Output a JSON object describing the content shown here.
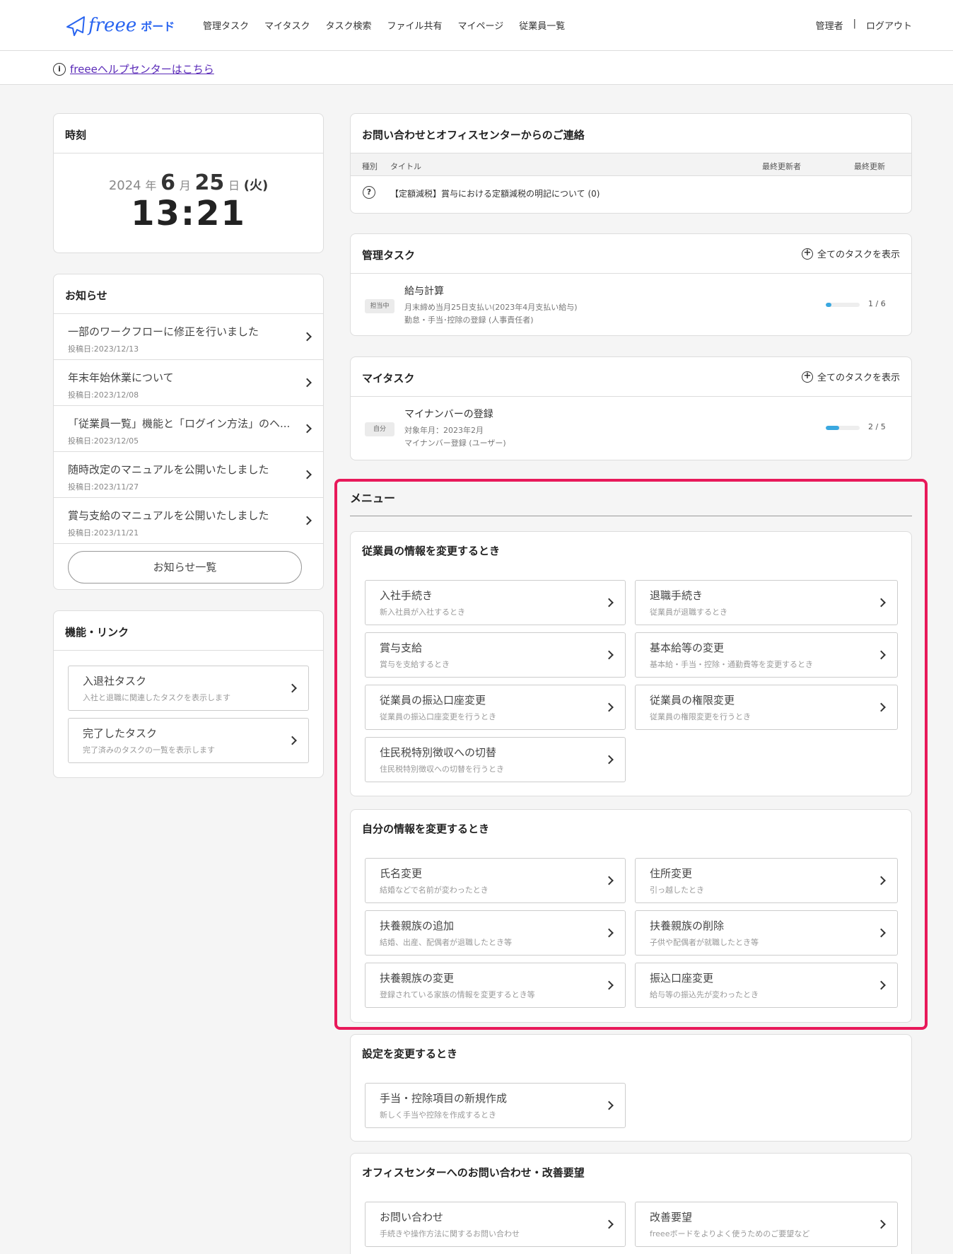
{
  "header": {
    "logo": {
      "text": "freee",
      "sub": "ボード"
    },
    "nav": [
      "管理タスク",
      "マイタスク",
      "タスク検索",
      "ファイル共有",
      "マイページ",
      "従業員一覧"
    ],
    "user": "管理者",
    "separator": "|",
    "logout": "ログアウト"
  },
  "help": {
    "icon": "info-icon",
    "text": "freeeヘルプセンターはこちら"
  },
  "clock": {
    "title": "時刻",
    "year": "2024",
    "year_unit": "年",
    "month": "6",
    "month_unit": "月",
    "day": "25",
    "day_unit": "日",
    "dow": "(火)",
    "time": "13:21"
  },
  "notices": {
    "title": "お知らせ",
    "items": [
      {
        "title": "一部のワークフローに修正を行いました",
        "date": "投稿日:2023/12/13"
      },
      {
        "title": "年末年始休業について",
        "date": "投稿日:2023/12/08"
      },
      {
        "title": "「従業員一覧」機能と「ログイン方法」のヘ...",
        "date": "投稿日:2023/12/05"
      },
      {
        "title": "随時改定のマニュアルを公開いたしました",
        "date": "投稿日:2023/11/27"
      },
      {
        "title": "賞与支給のマニュアルを公開いたしました",
        "date": "投稿日:2023/11/21"
      }
    ],
    "all_button": "お知らせ一覧"
  },
  "links": {
    "title": "機能・リンク",
    "items": [
      {
        "title": "入退社タスク",
        "sub": "入社と退職に関連したタスクを表示します"
      },
      {
        "title": "完了したタスク",
        "sub": "完了済みのタスクの一覧を表示します"
      }
    ]
  },
  "inquiries": {
    "title": "お問い合わせとオフィスセンターからのご連絡",
    "columns": {
      "type": "種別",
      "title": "タイトル",
      "updater": "最終更新者",
      "updated": "最終更新"
    },
    "rows": [
      {
        "icon": "question-icon",
        "title": "【定額減税】賞与における定額減税の明記について (0)"
      }
    ]
  },
  "admin_tasks": {
    "title": "管理タスク",
    "show_all": "全てのタスクを表示",
    "items": [
      {
        "badge": "担当中",
        "title": "給与計算",
        "sub1": "月末締め当月25日支払い(2023年4月支払い給与)",
        "sub2": "勤怠・手当･控除の登録 (人事責任者)",
        "progress": 0.167,
        "progress_text": "1 / 6"
      }
    ]
  },
  "my_tasks": {
    "title": "マイタスク",
    "show_all": "全てのタスクを表示",
    "items": [
      {
        "badge": "自分",
        "title": "マイナンバーの登録",
        "sub1": "対象年月：2023年2月",
        "sub2": "マイナンバー登録 (ユーザー)",
        "progress": 0.4,
        "progress_text": "2 / 5"
      }
    ]
  },
  "menu": {
    "title": "メニュー",
    "sections": [
      {
        "title": "従業員の情報を変更するとき",
        "items": [
          {
            "title": "入社手続き",
            "sub": "新入社員が入社するとき"
          },
          {
            "title": "退職手続き",
            "sub": "従業員が退職するとき"
          },
          {
            "title": "賞与支給",
            "sub": "賞与を支給するとき"
          },
          {
            "title": "基本給等の変更",
            "sub": "基本給・手当・控除・通勤費等を変更するとき"
          },
          {
            "title": "従業員の振込口座変更",
            "sub": "従業員の振込口座変更を行うとき"
          },
          {
            "title": "従業員の権限変更",
            "sub": "従業員の権限変更を行うとき"
          },
          {
            "title": "住民税特別徴収への切替",
            "sub": "住民税特別徴収への切替を行うとき"
          }
        ]
      },
      {
        "title": "自分の情報を変更するとき",
        "items": [
          {
            "title": "氏名変更",
            "sub": "結婚などで名前が変わったとき"
          },
          {
            "title": "住所変更",
            "sub": "引っ越したとき"
          },
          {
            "title": "扶養親族の追加",
            "sub": "結婚、出産、配偶者が退職したとき等"
          },
          {
            "title": "扶養親族の削除",
            "sub": "子供や配偶者が就職したとき等"
          },
          {
            "title": "扶養親族の変更",
            "sub": "登録されている家族の情報を変更するとき等"
          },
          {
            "title": "振込口座変更",
            "sub": "給与等の振込先が変わったとき"
          }
        ]
      },
      {
        "title": "設定を変更するとき",
        "items": [
          {
            "title": "手当・控除項目の新規作成",
            "sub": "新しく手当や控除を作成するとき"
          }
        ]
      },
      {
        "title": "オフィスセンターへのお問い合わせ・改善要望",
        "items": [
          {
            "title": "お問い合わせ",
            "sub": "手続きや操作方法に関するお問い合わせ"
          },
          {
            "title": "改善要望",
            "sub": "freeeボードをよりよく使うためのご要望など"
          }
        ]
      }
    ]
  },
  "colors": {
    "brand": "#2864f0",
    "highlight": "#e8195a",
    "progress": "#3aa8e0"
  }
}
